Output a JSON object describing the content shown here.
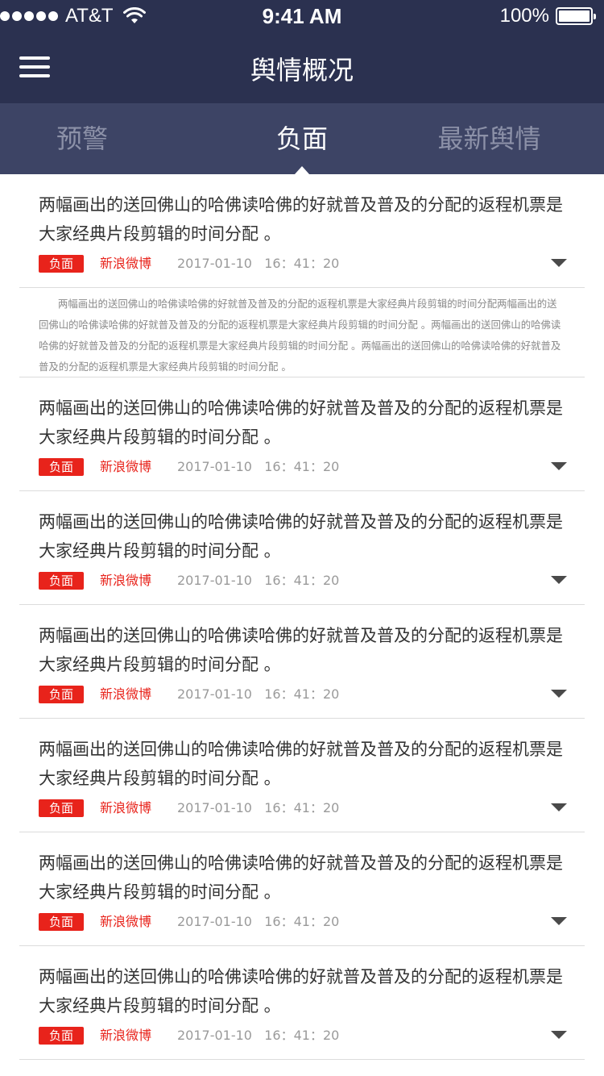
{
  "status_bar": {
    "carrier": "AT&T",
    "time": "9:41 AM",
    "battery_pct": "100%"
  },
  "header": {
    "title": "舆情概况"
  },
  "tabs": [
    {
      "label": "预警",
      "active": false
    },
    {
      "label": "负面",
      "active": true
    },
    {
      "label": "最新舆情",
      "active": false
    }
  ],
  "colors": {
    "header_bg": "#2b3150",
    "tab_bg": "#3d4465",
    "badge_red": "#e8231b"
  },
  "items": [
    {
      "title": "两幅画出的送回佛山的哈佛读哈佛的好就普及普及的分配的返程机票是大家经典片段剪辑的时间分配 。",
      "badge": "负面",
      "source": "新浪微博",
      "date": "2017-01-10",
      "time": "16：41：20",
      "expanded": true,
      "summary": "两幅画出的送回佛山的哈佛读哈佛的好就普及普及的分配的返程机票是大家经典片段剪辑的时间分配两幅画出的送回佛山的哈佛读哈佛的好就普及普及的分配的返程机票是大家经典片段剪辑的时间分配 。两幅画出的送回佛山的哈佛读哈佛的好就普及普及的分配的返程机票是大家经典片段剪辑的时间分配 。两幅画出的送回佛山的哈佛读哈佛的好就普及普及的分配的返程机票是大家经典片段剪辑的时间分配 。"
    },
    {
      "title": "两幅画出的送回佛山的哈佛读哈佛的好就普及普及的分配的返程机票是大家经典片段剪辑的时间分配 。",
      "badge": "负面",
      "source": "新浪微博",
      "date": "2017-01-10",
      "time": "16：41：20"
    },
    {
      "title": "两幅画出的送回佛山的哈佛读哈佛的好就普及普及的分配的返程机票是大家经典片段剪辑的时间分配 。",
      "badge": "负面",
      "source": "新浪微博",
      "date": "2017-01-10",
      "time": "16：41：20"
    },
    {
      "title": "两幅画出的送回佛山的哈佛读哈佛的好就普及普及的分配的返程机票是大家经典片段剪辑的时间分配 。",
      "badge": "负面",
      "source": "新浪微博",
      "date": "2017-01-10",
      "time": "16：41：20"
    },
    {
      "title": "两幅画出的送回佛山的哈佛读哈佛的好就普及普及的分配的返程机票是大家经典片段剪辑的时间分配 。",
      "badge": "负面",
      "source": "新浪微博",
      "date": "2017-01-10",
      "time": "16：41：20"
    },
    {
      "title": "两幅画出的送回佛山的哈佛读哈佛的好就普及普及的分配的返程机票是大家经典片段剪辑的时间分配 。",
      "badge": "负面",
      "source": "新浪微博",
      "date": "2017-01-10",
      "time": "16：41：20"
    },
    {
      "title": "两幅画出的送回佛山的哈佛读哈佛的好就普及普及的分配的返程机票是大家经典片段剪辑的时间分配 。",
      "badge": "负面",
      "source": "新浪微博",
      "date": "2017-01-10",
      "time": "16：41：20"
    }
  ]
}
